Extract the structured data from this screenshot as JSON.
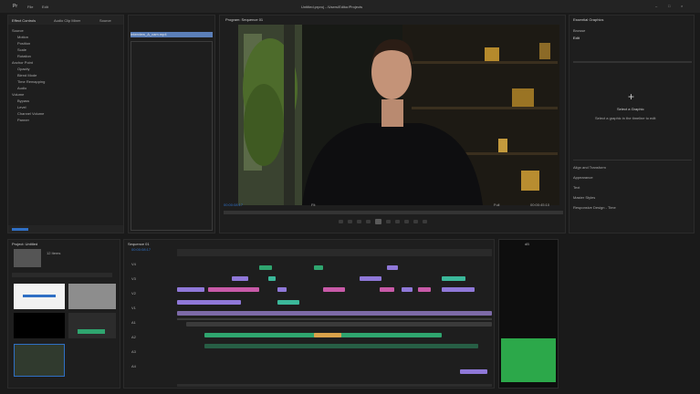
{
  "window": {
    "title": "Untitled.prproj - /Users/Editor/Projects",
    "menu_left": "Pr",
    "menu_items": [
      "File",
      "Edit"
    ],
    "controls": [
      "–",
      "□",
      "×"
    ]
  },
  "source_panel": {
    "tabs": [
      "Effect Controls",
      "Audio Clip Mixer",
      "Source"
    ],
    "rows": [
      "Source",
      "Motion",
      "Position",
      "Scale",
      "Rotation",
      "Anchor Point",
      "Opacity",
      "Blend Mode",
      "Time Remapping",
      "Audio",
      "Volume",
      "Bypass",
      "Level",
      "Channel Volume",
      "Panner"
    ]
  },
  "project_list": {
    "selected_item": "Interview_A_cam.mp4"
  },
  "program_monitor": {
    "title": "Program: Sequence 01",
    "timecode_left": "00:00:08:17",
    "timecode_right": "00:00:45:10",
    "fit": "Fit",
    "quality": "Full"
  },
  "essential_graphics": {
    "tabs": [
      "Essential Graphics",
      "Browse",
      "Edit"
    ],
    "empty_title": "Select a Graphic",
    "empty_hint": "Select a graphic in the timeline to edit",
    "plus_label": "+",
    "lower_rows": [
      "Align and Transform",
      "Appearance",
      "Text",
      "Master Styles",
      "Responsive Design - Time"
    ]
  },
  "project_panel": {
    "title": "Project: Untitled",
    "search_placeholder": "",
    "item_count": "12 Items",
    "thumbs": [
      "Graphic",
      "B-Roll",
      "Black Video",
      "Adjustment Layer",
      "Interview_A_cam"
    ]
  },
  "timeline": {
    "tab": "Sequence 01",
    "timecode": "00:00:08:17",
    "track_labels": [
      "V4",
      "V3",
      "V2",
      "V1",
      "A1",
      "A2",
      "A3",
      "A4"
    ]
  },
  "audio_meter": {
    "label": "dB",
    "level": 0.32
  },
  "colors": {
    "accent_blue": "#2f6fc4",
    "clip_green": "#2fa56f",
    "clip_pink": "#c85aa8",
    "clip_violet": "#8f78d8",
    "clip_teal": "#3bb89a",
    "meter_green": "#2ca84a"
  }
}
